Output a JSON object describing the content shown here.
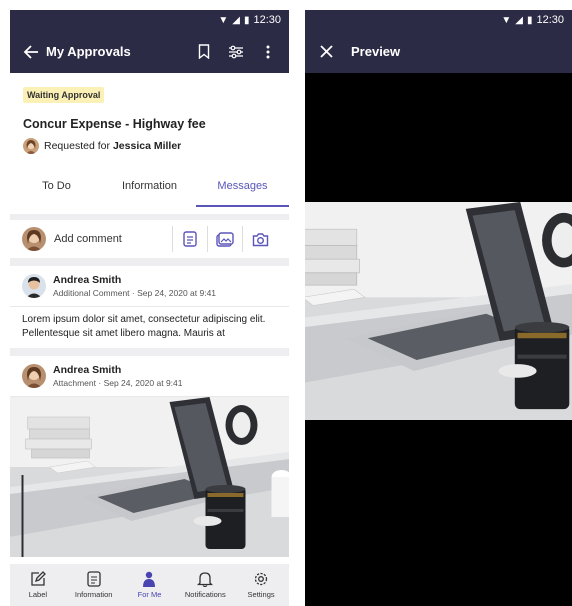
{
  "left": {
    "status": {
      "time": "12:30"
    },
    "appbar": {
      "title": "My Approvals"
    },
    "request": {
      "badge": "Waiting Approval",
      "title": "Concur Expense - Highway fee",
      "requested_for_label": "Requested for",
      "requested_for_name": "Jessica Miller"
    },
    "tabs": [
      {
        "label": "To Do",
        "active": false
      },
      {
        "label": "Information",
        "active": false
      },
      {
        "label": "Messages",
        "active": true
      }
    ],
    "comment": {
      "placeholder": "Add comment"
    },
    "messages": [
      {
        "author": "Andrea Smith",
        "type": "Additional Comment",
        "date": "Sep 24, 2020 at 9:41",
        "body": "Lorem ipsum dolor sit amet, consectetur adipiscing elit. Pellentesque sit amet libero magna. Mauris at"
      },
      {
        "author": "Andrea Smith",
        "type": "Attachment",
        "date": "Sep 24, 2020 at 9:41"
      }
    ],
    "bottom_nav": [
      {
        "label": "Label",
        "icon": "edit-icon"
      },
      {
        "label": "Information",
        "icon": "document-icon"
      },
      {
        "label": "For Me",
        "icon": "person-icon",
        "active": true
      },
      {
        "label": "Notifications",
        "icon": "bell-icon"
      },
      {
        "label": "Settings",
        "icon": "gear-icon"
      }
    ]
  },
  "right": {
    "status": {
      "time": "12:30"
    },
    "appbar": {
      "title": "Preview"
    }
  },
  "colors": {
    "appbar": "#2c2b45",
    "accent": "#5a55b8",
    "badge_bg": "#fbf0b5"
  }
}
